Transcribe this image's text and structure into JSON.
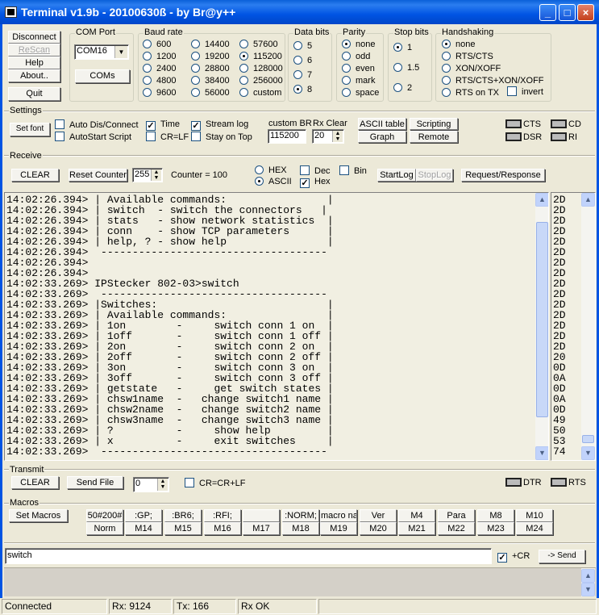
{
  "window": {
    "title": "Terminal v1.9b - 20100630ß - by Br@y++",
    "controls": [
      "_",
      "□",
      "×"
    ]
  },
  "left_buttons": {
    "disconnect": "Disconnect",
    "rescan": "ReScan",
    "help": "Help",
    "about": "About..",
    "quit": "Quit"
  },
  "com_port": {
    "label": "COM Port",
    "value": "COM16",
    "coms_button": "COMs"
  },
  "baud_rate": {
    "label": "Baud rate",
    "options": [
      "600",
      "1200",
      "2400",
      "4800",
      "9600",
      "14400",
      "19200",
      "28800",
      "38400",
      "56000",
      "57600",
      "115200",
      "128000",
      "256000",
      "custom"
    ],
    "selected": "115200"
  },
  "data_bits": {
    "label": "Data bits",
    "options": [
      "5",
      "6",
      "7",
      "8"
    ],
    "selected": "8"
  },
  "parity": {
    "label": "Parity",
    "options": [
      "none",
      "odd",
      "even",
      "mark",
      "space"
    ],
    "selected": "none"
  },
  "stop_bits": {
    "label": "Stop bits",
    "options": [
      "1",
      "1.5",
      "2"
    ],
    "selected": "1"
  },
  "handshaking": {
    "label": "Handshaking",
    "options": [
      "none",
      "RTS/CTS",
      "XON/XOFF",
      "RTS/CTS+XON/XOFF",
      "RTS on TX"
    ],
    "selected": "none",
    "invert_label": "invert",
    "invert": false
  },
  "settings": {
    "label": "Settings",
    "set_font": "Set font",
    "checkboxes": [
      {
        "label": "Auto Dis/Connect",
        "checked": false
      },
      {
        "label": "AutoStart Script",
        "checked": false
      },
      {
        "label": "Time",
        "checked": true
      },
      {
        "label": "CR=LF",
        "checked": false
      },
      {
        "label": "Stream log",
        "checked": true
      },
      {
        "label": "Stay on Top",
        "checked": false
      }
    ],
    "custom_br_label": "custom BR",
    "custom_br": "115200",
    "rx_clear_label": "Rx Clear",
    "rx_clear": "20",
    "ascii_table": "ASCII table",
    "graph": "Graph",
    "scripting": "Scripting",
    "remote": "Remote",
    "leds": [
      "CTS",
      "CD",
      "DSR",
      "RI"
    ]
  },
  "receive": {
    "label": "Receive",
    "clear": "CLEAR",
    "reset_counter": "Reset Counter",
    "counter_spin": "255",
    "counter_text": "Counter = 100",
    "hex_label": "HEX",
    "ascii_label": "ASCII",
    "mode": "ASCII",
    "dec_label": "Dec",
    "dec": false,
    "hex_chk_label": "Hex",
    "hex_chk": true,
    "bin_label": "Bin",
    "bin": false,
    "startlog": "StartLog",
    "stoplog": "StopLog",
    "request_response": "Request/Response",
    "lines": [
      "14:02:26.394> | Available commands:                |",
      "14:02:26.394> | switch  - switch the connectors   |",
      "14:02:26.394> | stats   - show network statistics  |",
      "14:02:26.394> | conn    - show TCP parameters      |",
      "14:02:26.394> | help, ? - show help                |",
      "14:02:26.394>  ------------------------------------",
      "14:02:26.394>",
      "14:02:26.394>",
      "14:02:33.269> IPStecker 802-03>switch",
      "14:02:33.269>  ------------------------------------",
      "14:02:33.269> |Switches:                           |",
      "14:02:33.269> | Available commands:                |",
      "14:02:33.269> | 1on        -     switch conn 1 on  |",
      "14:02:33.269> | 1off       -     switch conn 1 off |",
      "14:02:33.269> | 2on        -     switch conn 2 on  |",
      "14:02:33.269> | 2off       -     switch conn 2 off |",
      "14:02:33.269> | 3on        -     switch conn 3 on  |",
      "14:02:33.269> | 3off       -     switch conn 3 off |",
      "14:02:33.269> | getstate   -     get switch states |",
      "14:02:33.269> | chsw1name  -   change switch1 name |",
      "14:02:33.269> | chsw2name  -   change switch2 name |",
      "14:02:33.269> | chsw3name  -   change switch3 name |",
      "14:02:33.269> | ?          -     show help         |",
      "14:02:33.269> | x          -     exit switches     |",
      "14:02:33.269>  ------------------------------------"
    ],
    "hex_lines": [
      "2D",
      "2D",
      "2D",
      "2D",
      "2D",
      "2D",
      "2D",
      "2D",
      "2D",
      "2D",
      "2D",
      "2D",
      "2D",
      "2D",
      "2D",
      "20",
      "0D",
      "0A",
      "0D",
      "0A",
      "0D",
      "49",
      "50",
      "53",
      "74"
    ]
  },
  "transmit": {
    "label": "Transmit",
    "clear": "CLEAR",
    "send_file": "Send File",
    "spin": "0",
    "crcrlf_label": "CR=CR+LF",
    "crcrlf": false,
    "leds": [
      "DTR",
      "RTS"
    ]
  },
  "macros": {
    "label": "Macros",
    "set_macros": "Set Macros",
    "row1": [
      "50#200#",
      ":GP;",
      ":BR6;",
      ":RFI;",
      "",
      ":NORM;",
      "macro nar",
      "Ver",
      "M4",
      "Para",
      "M8",
      "M10"
    ],
    "row2": [
      "Norm",
      "M14",
      "M15",
      "M16",
      "M17",
      "M18",
      "M19",
      "M20",
      "M21",
      "M22",
      "M23",
      "M24"
    ]
  },
  "send": {
    "input": "switch",
    "plus_cr_label": "+CR",
    "plus_cr": true,
    "send_button": "-> Send"
  },
  "status": {
    "connection": "Connected",
    "rx": "Rx: 9124",
    "tx": "Tx: 166",
    "rx_state": "Rx OK"
  }
}
